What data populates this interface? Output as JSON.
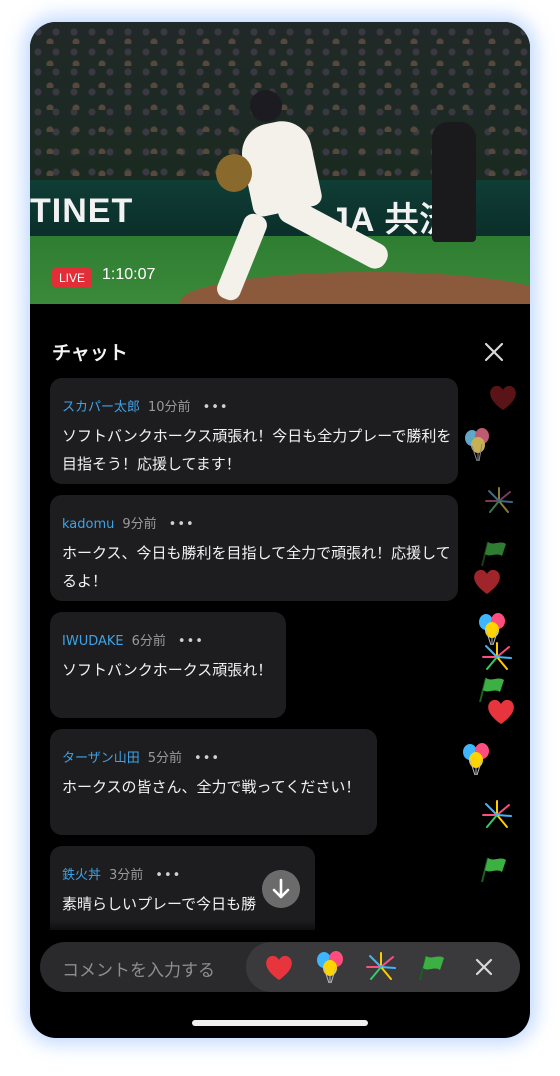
{
  "video": {
    "live_label": "LIVE",
    "elapsed_time": "1:10:07",
    "banner_left": "TINET",
    "banner_right": "JA 共済"
  },
  "chat": {
    "title": "チャット",
    "messages": [
      {
        "user": "スカパー太郎",
        "time": "10分前",
        "dots": "•••",
        "text": "ソフトバンクホークス頑張れ！今日も全力プレーで勝利を目指そう！応援してます！"
      },
      {
        "user": "kadomu",
        "time": "9分前",
        "dots": "•••",
        "text": "ホークス、今日も勝利を目指して全力で頑張れ！応援してるよ！"
      },
      {
        "user": "IWUDAKE",
        "time": "6分前",
        "dots": "•••",
        "text": "ソフトバンクホークス頑張れ！"
      },
      {
        "user": "ターザン山田",
        "time": "5分前",
        "dots": "•••",
        "text": "ホークスの皆さん、全力で戦ってください！"
      },
      {
        "user": "鉄火丼",
        "time": "3分前",
        "dots": "•••",
        "text": "素晴らしいプレーで今日も勝"
      }
    ]
  },
  "composer": {
    "placeholder": "コメントを入力する",
    "reactions": [
      "heart-icon",
      "balloons-icon",
      "fireworks-icon",
      "flag-icon"
    ]
  },
  "colors": {
    "accent_blue": "#3fa2e6",
    "live_red": "#e32d37",
    "bubble_bg": "#1d1d1f"
  }
}
